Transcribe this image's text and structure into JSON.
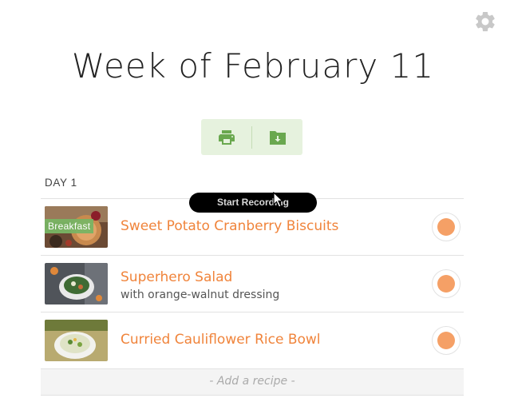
{
  "header": {
    "title": "Week of February 11",
    "settings_icon": "gear-icon"
  },
  "actions": {
    "print_icon": "printer-icon",
    "download_icon": "folder-download-icon"
  },
  "day": {
    "label": "DAY 1"
  },
  "recipes": [
    {
      "title": "Sweet Potato Cranberry Biscuits",
      "subtitle": "",
      "badge": "Breakfast"
    },
    {
      "title": "Superhero Salad",
      "subtitle": "with orange-walnut dressing",
      "badge": ""
    },
    {
      "title": "Curried Cauliflower Rice Bowl",
      "subtitle": "",
      "badge": ""
    }
  ],
  "add_recipe": {
    "label": "- Add a recipe -"
  },
  "overlay": {
    "recording_label": "Start Recording"
  },
  "colors": {
    "accent": "#f0843b",
    "action_bg": "#e6f2de",
    "icon_green": "#6aa84f"
  }
}
